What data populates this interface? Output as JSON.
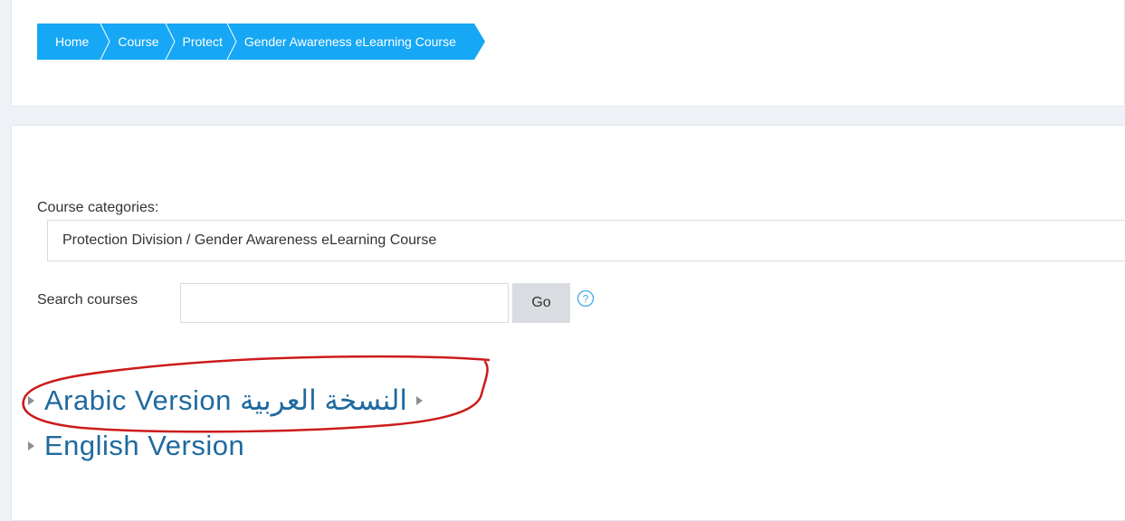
{
  "breadcrumb": {
    "items": [
      {
        "label": "Home"
      },
      {
        "label": "Course"
      },
      {
        "label": "Protect"
      },
      {
        "label": "Gender Awareness eLearning Course"
      }
    ]
  },
  "filters": {
    "category_label": "Course categories:",
    "category_selected": "Protection Division / Gender Awareness eLearning Course",
    "search_label": "Search courses",
    "search_value": "",
    "go_label": "Go"
  },
  "courses": [
    {
      "label": "Arabic Version النسخة العربية"
    },
    {
      "label": "English Version"
    }
  ],
  "colors": {
    "breadcrumb_bg": "#16a7f5",
    "course_link": "#1f6a9e",
    "annotation": "#cc1b1b"
  }
}
